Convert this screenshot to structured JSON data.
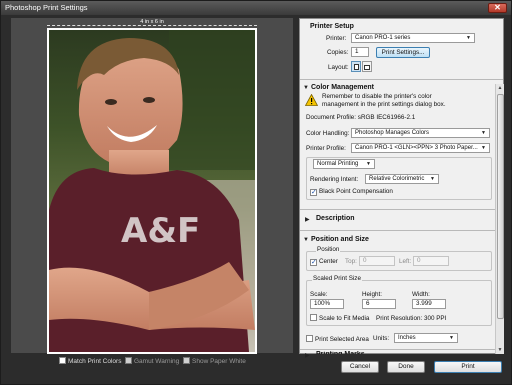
{
  "window": {
    "title": "Photoshop Print Settings",
    "close_label": "✕"
  },
  "preview": {
    "dimension_label": "4 in x 6 in",
    "bottom_checks": [
      {
        "label": "Match Print Colors",
        "checked": false,
        "enabled": true
      },
      {
        "label": "Gamut Warning",
        "checked": false,
        "enabled": false
      },
      {
        "label": "Show Paper White",
        "checked": false,
        "enabled": false
      }
    ]
  },
  "printer_setup": {
    "title": "Printer Setup",
    "printer_label": "Printer:",
    "printer_value": "Canon PRO-1 series",
    "copies_label": "Copies:",
    "copies_value": "1",
    "print_settings_label": "Print Settings...",
    "layout_label": "Layout:"
  },
  "color_management": {
    "title": "Color Management",
    "warning_text_1": "Remember to disable the printer's color",
    "warning_text_2": "management in the print settings dialog box.",
    "doc_profile_label": "Document Profile:",
    "doc_profile_value": "sRGB IEC61966-2.1",
    "color_handling_label": "Color Handling:",
    "color_handling_value": "Photoshop Manages Colors",
    "printer_profile_label": "Printer Profile:",
    "printer_profile_value": "Canon PRO-1 <GLN><PPN> 3 Photo Paper...",
    "mode_value": "Normal Printing",
    "rendering_intent_label": "Rendering Intent:",
    "rendering_intent_value": "Relative Colorimetric",
    "bpc_label": "Black Point Compensation",
    "bpc_checked": true
  },
  "description": {
    "title": "Description"
  },
  "position_size": {
    "title": "Position and Size",
    "position_group": "Position",
    "center_label": "Center",
    "center_checked": true,
    "top_label": "Top:",
    "top_value": "0",
    "left_label": "Left:",
    "left_value": "0",
    "scaled_group": "Scaled Print Size",
    "scale_label": "Scale:",
    "scale_value": "100%",
    "height_label": "Height:",
    "height_value": "6",
    "width_label": "Width:",
    "width_value": "3.999",
    "scale_to_fit_label": "Scale to Fit Media",
    "print_resolution": "Print Resolution: 300 PPI",
    "print_selected_label": "Print Selected Area",
    "units_label": "Units:",
    "units_value": "Inches"
  },
  "printing_marks": {
    "title": "Printing Marks"
  },
  "footer": {
    "cancel": "Cancel",
    "done": "Done",
    "print": "Print"
  },
  "colors": {
    "accent": "#3c7fb1",
    "window_bg": "#2c2c2c",
    "panel_bg": "#f0f0f0"
  }
}
